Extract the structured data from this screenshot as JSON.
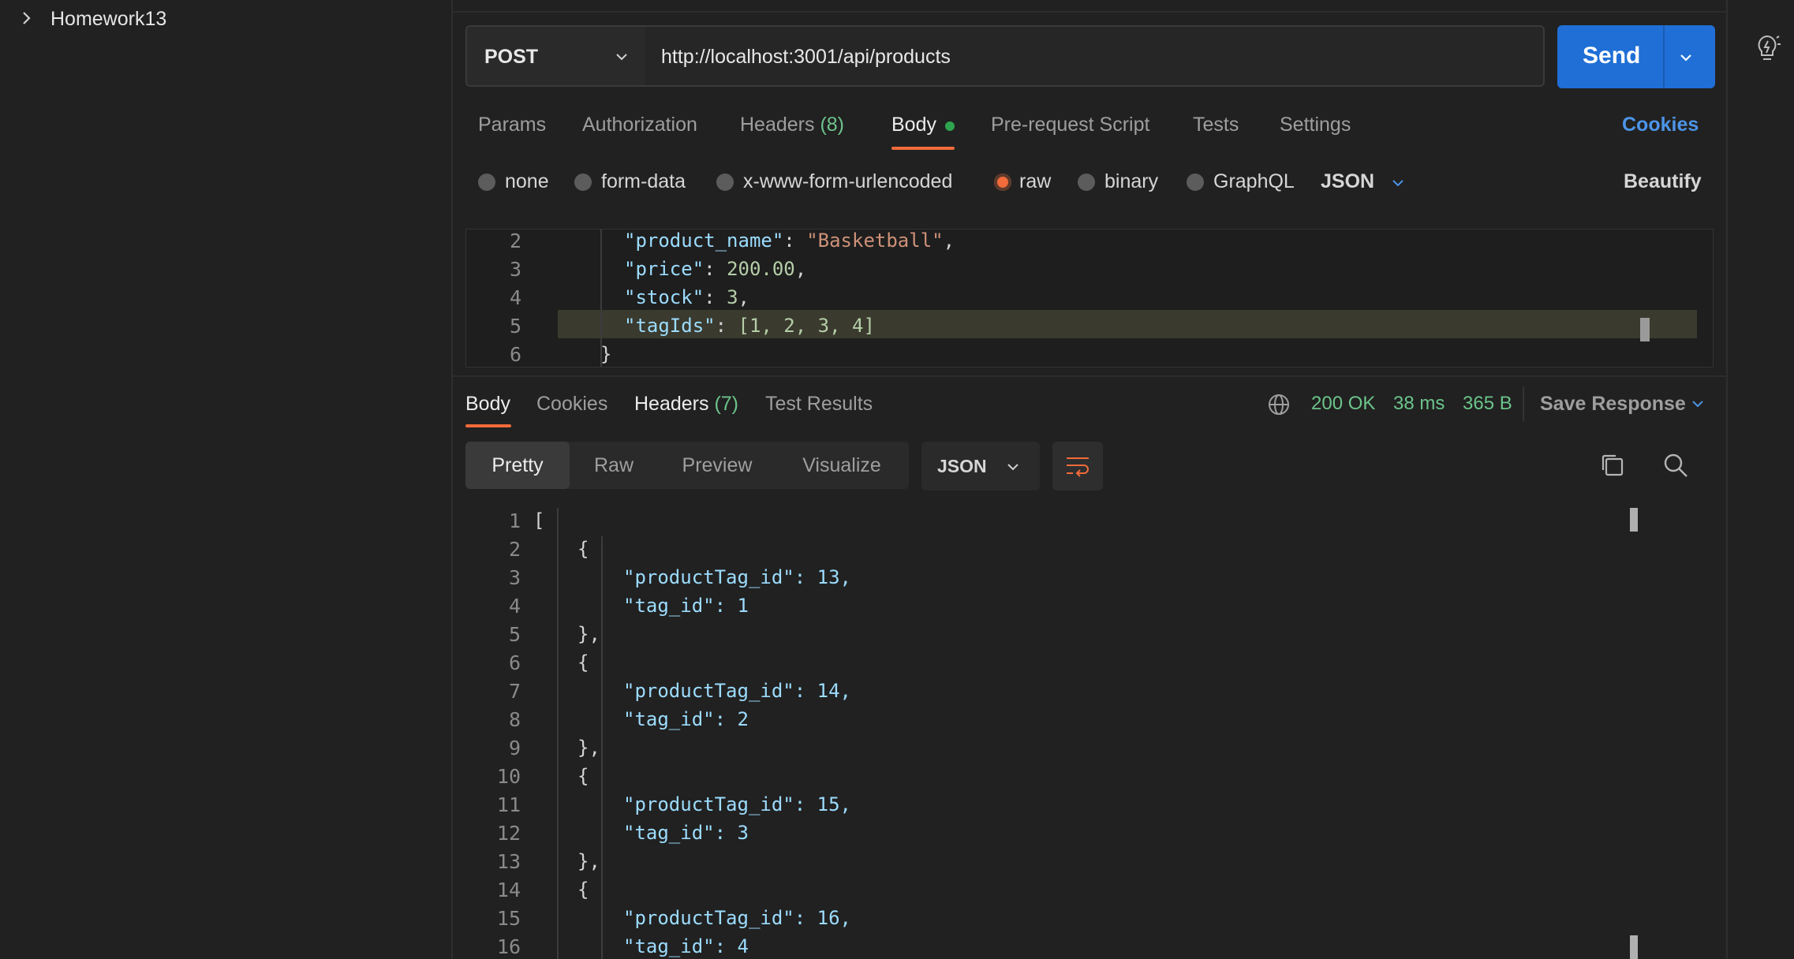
{
  "sidebar": {
    "collection_name": "Homework13"
  },
  "request": {
    "method": "POST",
    "url": "http://localhost:3001/api/products",
    "send_label": "Send",
    "tabs": {
      "params": "Params",
      "authorization": "Authorization",
      "headers": "Headers",
      "headers_count": "(8)",
      "body": "Body",
      "pre_request": "Pre-request Script",
      "tests": "Tests",
      "settings": "Settings",
      "cookies": "Cookies"
    },
    "body_types": {
      "none": "none",
      "form_data": "form-data",
      "urlencoded": "x-www-form-urlencoded",
      "raw": "raw",
      "binary": "binary",
      "graphql": "GraphQL",
      "language": "JSON",
      "beautify": "Beautify"
    },
    "editor": {
      "line_numbers": [
        "2",
        "3",
        "4",
        "5",
        "6"
      ],
      "lines": [
        {
          "key": "\"product_name\"",
          "value": "\"Basketball\"",
          "trail": ","
        },
        {
          "key": "\"price\"",
          "value": "200.00",
          "trail": ","
        },
        {
          "key": "\"stock\"",
          "value": "3",
          "trail": ","
        },
        {
          "key": "\"tagIds\"",
          "value": "[1, 2, 3, 4]",
          "trail": ""
        },
        {
          "text": "}"
        }
      ]
    }
  },
  "response": {
    "tabs": {
      "body": "Body",
      "cookies": "Cookies",
      "headers": "Headers",
      "headers_count": "(7)",
      "test_results": "Test Results"
    },
    "status": "200 OK",
    "time": "38 ms",
    "size": "365 B",
    "save_response": "Save Response",
    "views": {
      "pretty": "Pretty",
      "raw": "Raw",
      "preview": "Preview",
      "visualize": "Visualize"
    },
    "format": "JSON",
    "line_numbers": [
      "1",
      "2",
      "3",
      "4",
      "5",
      "6",
      "7",
      "8",
      "9",
      "10",
      "11",
      "12",
      "13",
      "14",
      "15",
      "16"
    ],
    "lines": [
      "[",
      "{",
      "\"productTag_id\": 13,",
      "\"tag_id\": 1",
      "},",
      "{",
      "\"productTag_id\": 14,",
      "\"tag_id\": 2",
      "},",
      "{",
      "\"productTag_id\": 15,",
      "\"tag_id\": 3",
      "},",
      "{",
      "\"productTag_id\": 16,",
      "\"tag_id\": 4"
    ]
  },
  "colors": {
    "accent": "#f26b3a",
    "send": "#1f6fd6",
    "link": "#4d94e8",
    "status_ok": "#6cc48b"
  },
  "icons": [
    "chevron-right-icon",
    "chevron-down-icon",
    "globe-icon",
    "wrap-lines-icon",
    "copy-icon",
    "search-icon",
    "lightbulb-icon"
  ]
}
